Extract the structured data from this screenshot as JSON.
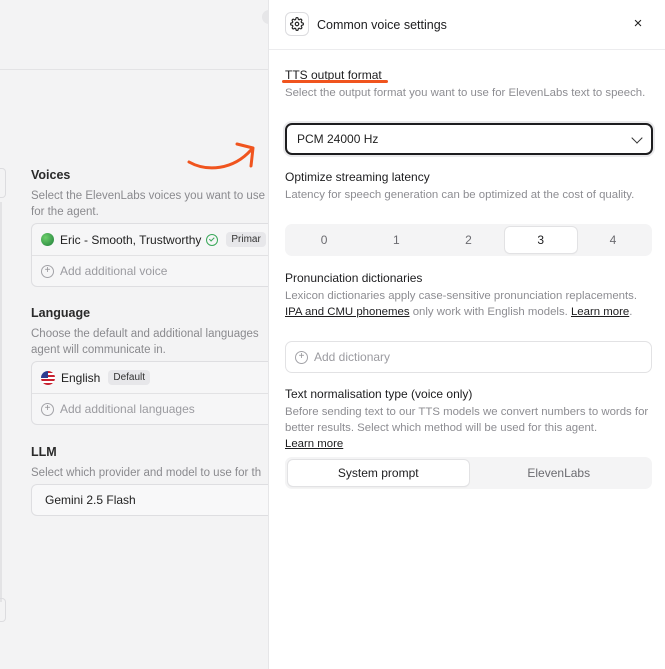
{
  "background": {
    "voices": {
      "title": "Voices",
      "description_line1": "Select the ElevenLabs voices you want to use",
      "description_line2": "for the agent.",
      "voice_name": "Eric - Smooth, Trustworthy",
      "voice_badge": "Primar",
      "add_voice": "Add additional voice"
    },
    "language": {
      "title": "Language",
      "description_line1": "Choose the default and additional languages",
      "description_line2": "agent will communicate in.",
      "language_name": "English",
      "language_badge": "Default",
      "add_language": "Add additional languages"
    },
    "llm": {
      "title": "LLM",
      "description": "Select which provider and model to use for th",
      "model": "Gemini 2.5 Flash"
    }
  },
  "panel": {
    "title": "Common voice settings",
    "close": "×",
    "tts": {
      "title": "TTS output format",
      "description": "Select the output format you want to use for ElevenLabs text to speech.",
      "selected": "PCM 24000 Hz"
    },
    "latency": {
      "title": "Optimize streaming latency",
      "description": "Latency for speech generation can be optimized at the cost of quality.",
      "options": [
        "0",
        "1",
        "2",
        "3",
        "4"
      ],
      "selected": "3"
    },
    "pronunciation": {
      "title": "Pronunciation dictionaries",
      "description_a": "Lexicon dictionaries apply case-sensitive pronunciation replacements. ",
      "link_ipa": "IPA and CMU phonemes",
      "description_b": " only work with English models. ",
      "link_learn": "Learn more",
      "description_c": ".",
      "add_dictionary": "Add dictionary"
    },
    "normalisation": {
      "title": "Text normalisation type (voice only)",
      "description": "Before sending text to our TTS models we convert numbers to words for better results. Select which method will be used for this agent.",
      "link_learn": "Learn more",
      "options": [
        "System prompt",
        "ElevenLabs"
      ],
      "selected": "System prompt"
    }
  },
  "colors": {
    "annotation": "#f0541e",
    "verified": "#3aa85a"
  }
}
